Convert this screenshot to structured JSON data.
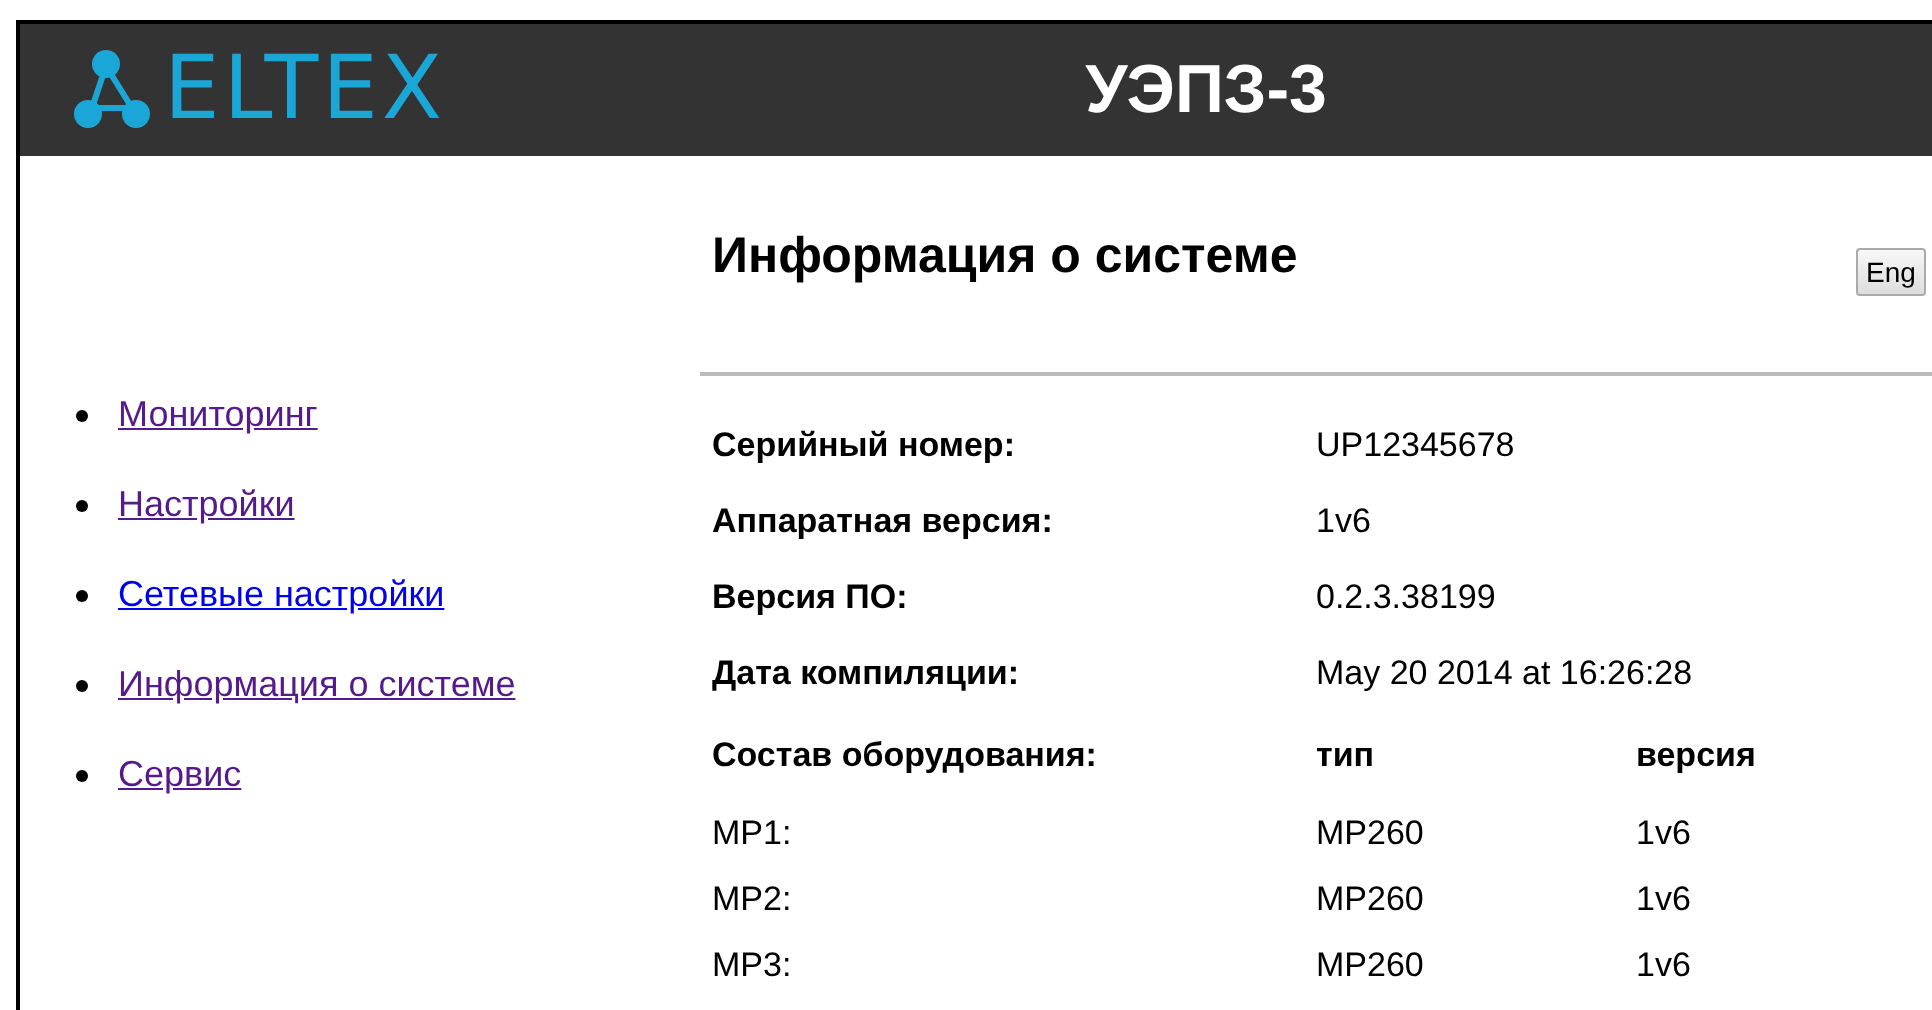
{
  "header": {
    "logo_text": "ELTEX",
    "title": "УЭПЗ-3"
  },
  "sidebar": {
    "items": [
      {
        "label": "Мониторинг",
        "visited": true
      },
      {
        "label": "Настройки",
        "visited": true
      },
      {
        "label": "Сетевые настройки",
        "visited": false
      },
      {
        "label": "Информация о системе",
        "visited": true
      },
      {
        "label": "Сервис",
        "visited": true
      }
    ]
  },
  "page_title": "Информация о системе",
  "language_button": "Eng",
  "info": [
    {
      "label": "Серийный номер:",
      "value": "UP12345678"
    },
    {
      "label": "Аппаратная версия:",
      "value": "1v6"
    },
    {
      "label": "Версия ПО:",
      "value": "0.2.3.38199"
    },
    {
      "label": "Дата компиляции:",
      "value": "May 20 2014 at 16:26:28"
    }
  ],
  "equipment": {
    "label": "Состав оборудования:",
    "columns": [
      "тип",
      "версия"
    ],
    "rows": [
      {
        "name": "MP1:",
        "type": "MP260",
        "version": "1v6"
      },
      {
        "name": "MP2:",
        "type": "MP260",
        "version": "1v6"
      },
      {
        "name": "MP3:",
        "type": "MP260",
        "version": "1v6"
      }
    ]
  }
}
